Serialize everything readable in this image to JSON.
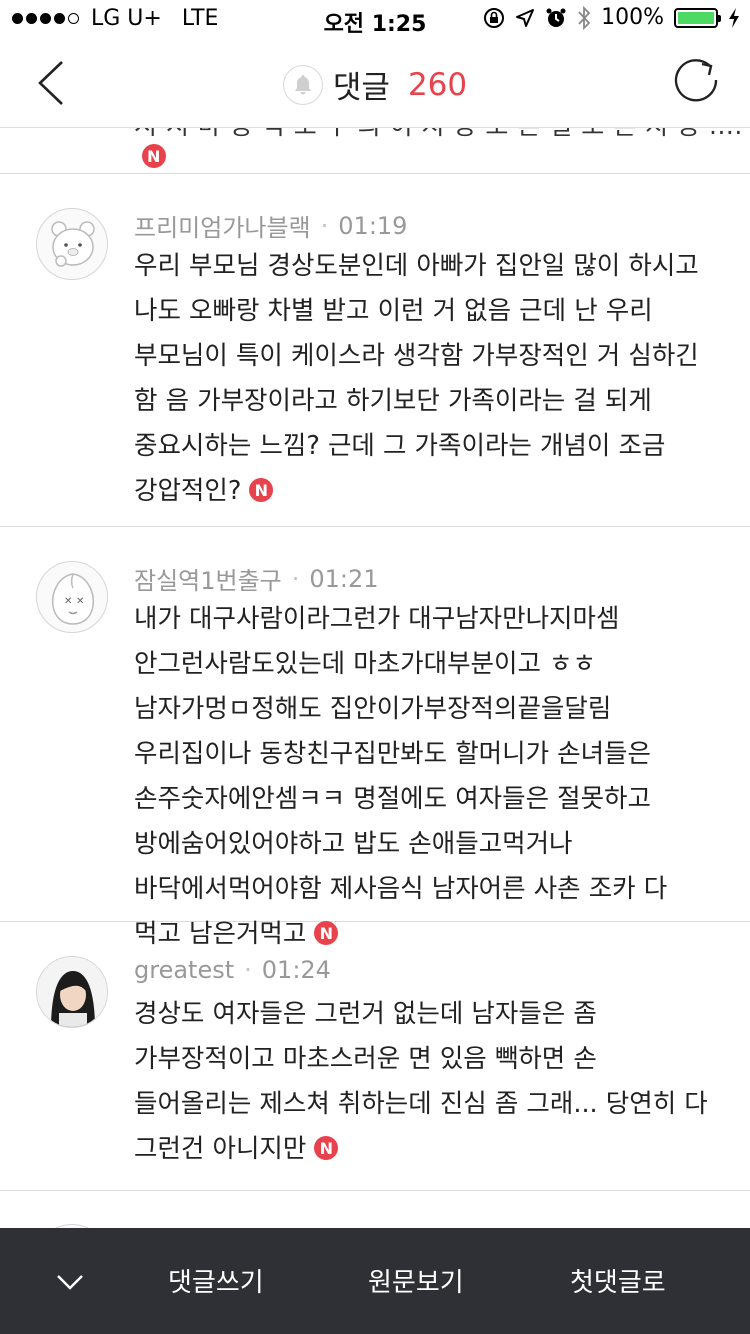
{
  "status_bar": {
    "carrier": "LG U+",
    "network": "LTE",
    "time": "오전 1:25",
    "battery": "100%"
  },
  "header": {
    "title": "댓글",
    "count": "260"
  },
  "partial_comment": {
    "text": "시 시 마 농 익 소 구 의 이 지 농 오 흔 실 오 흔 지 농 ...."
  },
  "comments": [
    {
      "author": "프리미엄가나블랙",
      "time": "01:19",
      "text": "우리 부모님 경상도분인데 아빠가 집안일 많이 하시고 나도 오빠랑 차별 받고 이런 거 없음 근데 난 우리 부모님이 특이 케이스라 생각함 가부장적인 거 심하긴 함 음 가부장이라고 하기보단 가족이라는 걸 되게 중요시하는 느낌? 근데 그 가족이라는 개념이 조금 강압적인?",
      "badge": "N"
    },
    {
      "author": "잠실역1번출구",
      "time": "01:21",
      "text": "내가 대구사람이라그런가 대구남자만나지마셈 안그런사람도있는데 마초가대부분이고 ㅎㅎ 남자가멍ㅁ정해도 집안이가부장적의끝을달림 우리집이나 동창친구집만봐도 할머니가 손녀들은 손주숫자에안셈ㅋㅋ 명절에도 여자들은 절못하고 방에숨어있어야하고 밥도 손애들고먹거나 바닥에서먹어야함 제사음식 남자어른 사촌 조카 다 먹고 남은거먹고",
      "badge": "N"
    },
    {
      "author": "greatest",
      "time": "01:24",
      "text": "경상도 여자들은 그런거 없는데 남자들은 좀 가부장적이고 마초스러운 면 있음 빽하면 손 들어올리는 제스쳐 취하는데 진심 좀 그래... 당연히 다 그런건 아니지만",
      "badge": "N"
    }
  ],
  "toolbar": {
    "write": "댓글쓰기",
    "original": "원문보기",
    "first": "첫댓글로"
  },
  "colors": {
    "accent": "#e8434c",
    "toolbar_bg": "#2f3035",
    "battery": "#4cd964"
  }
}
